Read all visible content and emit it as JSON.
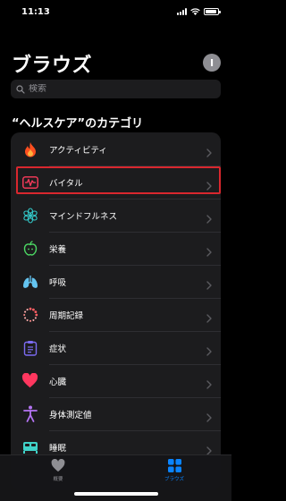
{
  "status_bar": {
    "time": "11:13",
    "battery_level": 0.95
  },
  "header": {
    "title": "ブラウズ",
    "avatar_initial": "I"
  },
  "search": {
    "placeholder": "検索",
    "value": ""
  },
  "section": {
    "title": "“ヘルスケア”のカテゴリ"
  },
  "categories": [
    {
      "label": "アクティビティ",
      "icon": "flame-icon",
      "color": "#ff4f1f"
    },
    {
      "label": "バイタル",
      "icon": "vitals-waveform-icon",
      "color": "#ff3b5c",
      "highlighted": true
    },
    {
      "label": "マインドフルネス",
      "icon": "mindfulness-flower-icon",
      "color": "#33c8c8"
    },
    {
      "label": "栄養",
      "icon": "apple-icon",
      "color": "#4cd964"
    },
    {
      "label": "呼吸",
      "icon": "lungs-icon",
      "color": "#64c4f0"
    },
    {
      "label": "周期記録",
      "icon": "cycle-tracking-icon",
      "color": "#ff5e63"
    },
    {
      "label": "症状",
      "icon": "clipboard-icon",
      "color": "#7c6bf2"
    },
    {
      "label": "心臓",
      "icon": "heart-icon",
      "color": "#ff375f"
    },
    {
      "label": "身体測定値",
      "icon": "body-figure-icon",
      "color": "#b574f4"
    },
    {
      "label": "睡眠",
      "icon": "bed-icon",
      "color": "#40d2c8"
    }
  ],
  "tab_bar": {
    "tabs": [
      {
        "label": "概要",
        "icon": "heart-icon",
        "active": false
      },
      {
        "label": "ブラウズ",
        "icon": "grid-icon",
        "active": true
      }
    ]
  },
  "colors": {
    "accent": "#0a84ff",
    "highlight_border": "#d9272e",
    "inactive": "#8e8e93"
  }
}
